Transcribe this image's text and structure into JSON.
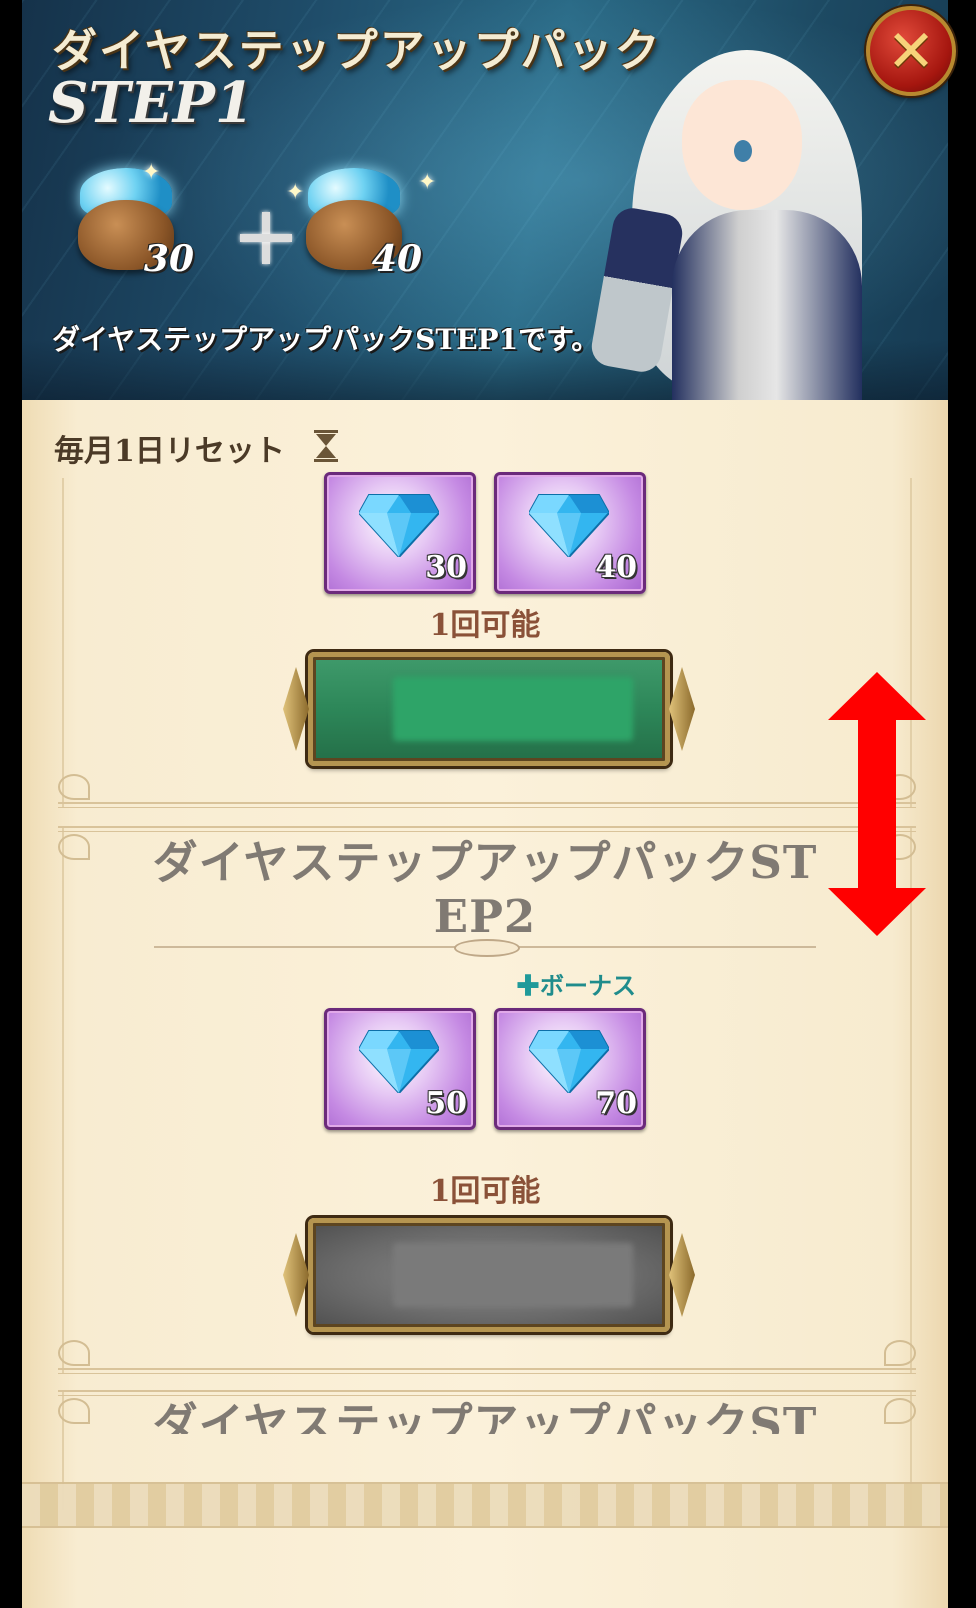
{
  "banner": {
    "title": "ダイヤステップアップパック",
    "step": "STEP1",
    "bag1_count": "30",
    "bag2_count": "40",
    "description": "ダイヤステップアップパックSTEP1です。"
  },
  "reset_label": "毎月1日リセット",
  "pack1": {
    "items": [
      {
        "count": "30"
      },
      {
        "count": "40"
      }
    ],
    "limit": "1回可能"
  },
  "pack2": {
    "title_line1": "ダイヤステップアップパックST",
    "title_line2": "EP2",
    "bonus": "ボーナス",
    "items": [
      {
        "count": "50"
      },
      {
        "count": "70"
      }
    ],
    "limit": "1回可能"
  },
  "pack3": {
    "title_line1": "ダイヤステップアップパックST"
  },
  "colors": {
    "scroll_arrow": "#ff0000",
    "buy_enabled": "#2d8759",
    "buy_disabled": "#6a6a6a"
  },
  "icons": {
    "close": "close-icon",
    "hourglass": "hourglass-icon",
    "diamond": "diamond-icon",
    "scroll": "vertical-double-arrow-icon"
  }
}
